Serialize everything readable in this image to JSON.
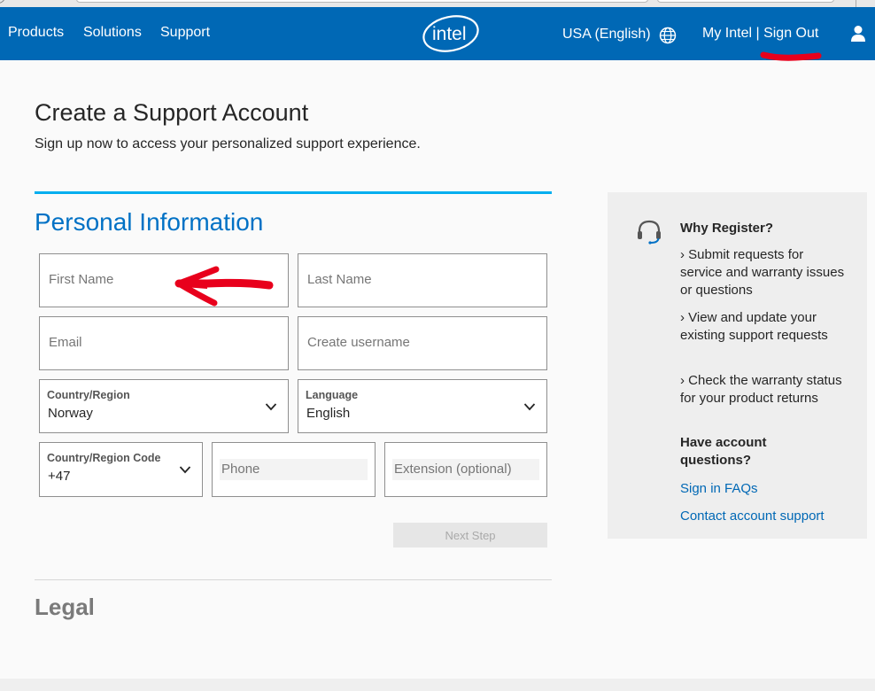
{
  "nav": {
    "items": [
      "Products",
      "Solutions",
      "Support"
    ],
    "logo_text": "intel",
    "region": "USA (English)",
    "account_links": "My Intel | Sign Out"
  },
  "page": {
    "title": "Create a Support Account",
    "subtitle": "Sign up now to access your personalized support experience."
  },
  "personal": {
    "section_title": "Personal Information",
    "first_name_placeholder": "First Name",
    "last_name_placeholder": "Last Name",
    "email_placeholder": "Email",
    "username_placeholder": "Create username",
    "country": {
      "label": "Country/Region",
      "value": "Norway"
    },
    "language": {
      "label": "Language",
      "value": "English"
    },
    "country_code": {
      "label": "Country/Region Code",
      "value": "+47"
    },
    "phone_placeholder": "Phone",
    "extension_placeholder": "Extension (optional)",
    "next_button": "Next Step"
  },
  "legal": {
    "title": "Legal"
  },
  "sidebar": {
    "title": "Why Register?",
    "reasons": [
      "› Submit requests for service and warranty issues or questions",
      "› View and update your existing support requests",
      "› Check the warranty status for your product returns"
    ],
    "question": "Have account questions?",
    "links": [
      "Sign in FAQs",
      "Contact account support"
    ]
  },
  "colors": {
    "brand_blue": "#0068b5",
    "accent_cyan": "#00aeef",
    "annotation_red": "#e8001c"
  }
}
